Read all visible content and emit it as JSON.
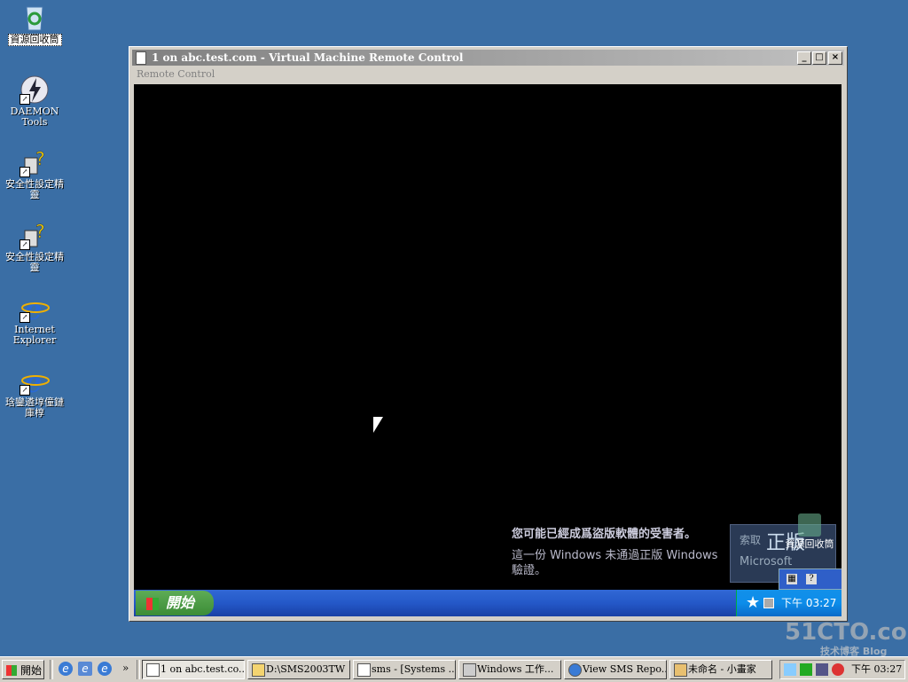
{
  "desktop": {
    "icons": [
      {
        "name": "recycle-bin",
        "label": "資源回收筒"
      },
      {
        "name": "daemon-tools",
        "label": "DAEMON Tools"
      },
      {
        "name": "security-wizard-1",
        "label": "安全性設定精靈"
      },
      {
        "name": "security-wizard-2",
        "label": "安全性設定精靈"
      },
      {
        "name": "internet-explorer",
        "label": "Internet Explorer"
      },
      {
        "name": "ie-shortcut-2",
        "label": "琀鑾遴埻僮鏈庫椁"
      }
    ]
  },
  "vm_window": {
    "title": "1 on abc.test.com - Virtual Machine Remote Control",
    "menu": "Remote Control",
    "buttons": {
      "minimize": "_",
      "maximize": "□",
      "close": "×"
    }
  },
  "vm_screen": {
    "notice_heading": "您可能已經成爲盜版軟體的受害者。",
    "notice_body": "這一份 Windows 未通過正版 Windows 驗證。",
    "genuine_text1": "索取",
    "genuine_text2": "正版",
    "genuine_text3": "Microsoft",
    "recycle_label": "資源回收筒",
    "start_label": "開始",
    "clock": "下午 03:27"
  },
  "taskbar": {
    "start_label": "開始",
    "quicklaunch_more": "»",
    "tasks": [
      {
        "label": "1 on abc.test.co...",
        "active": true
      },
      {
        "label": "D:\\SMS2003TW",
        "active": false
      },
      {
        "label": "sms - [Systems ...",
        "active": false
      },
      {
        "label": "Windows 工作...",
        "active": false
      },
      {
        "label": "View SMS Repo...",
        "active": false
      },
      {
        "label": "未命名 - 小畫家",
        "active": false
      }
    ],
    "clock": "下午 03:27"
  },
  "watermark": {
    "main": "51CTO.com",
    "sub": "技术博客  Blog"
  },
  "colors": {
    "desktop": "#3a6ea5",
    "xp_taskbar": "#2458c8",
    "xp_start": "#3c8c36",
    "xp_tray": "#0d8dea"
  }
}
